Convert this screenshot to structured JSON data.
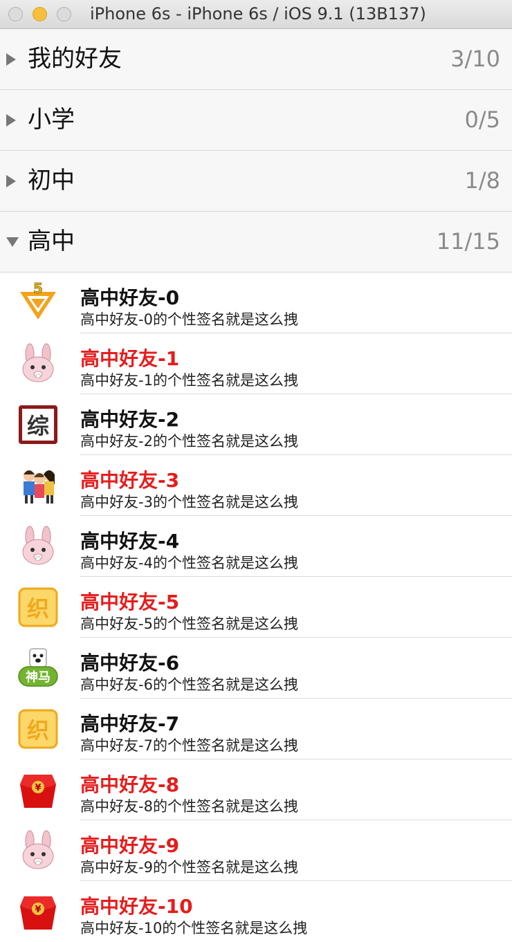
{
  "window": {
    "title": "iPhone 6s - iPhone 6s / iOS 9.1 (13B137)"
  },
  "groups": [
    {
      "name": "我的好友",
      "count": "3/10",
      "expanded": false
    },
    {
      "name": "小学",
      "count": "0/5",
      "expanded": false
    },
    {
      "name": "初中",
      "count": "1/8",
      "expanded": false
    },
    {
      "name": "高中",
      "count": "11/15",
      "expanded": true
    }
  ],
  "friends": [
    {
      "name": "高中好友-0",
      "signature": "高中好友-0的个性签名就是这么拽",
      "vip": false,
      "icon": "v5-badge-icon"
    },
    {
      "name": "高中好友-1",
      "signature": "高中好友-1的个性签名就是这么拽",
      "vip": true,
      "icon": "bunny-icon"
    },
    {
      "name": "高中好友-2",
      "signature": "高中好友-2的个性签名就是这么拽",
      "vip": false,
      "icon": "zong-badge-icon"
    },
    {
      "name": "高中好友-3",
      "signature": "高中好友-3的个性签名就是这么拽",
      "vip": true,
      "icon": "people-group-icon"
    },
    {
      "name": "高中好友-4",
      "signature": "高中好友-4的个性签名就是这么拽",
      "vip": false,
      "icon": "bunny-icon"
    },
    {
      "name": "高中好友-5",
      "signature": "高中好友-5的个性签名就是这么拽",
      "vip": true,
      "icon": "zhi-badge-icon"
    },
    {
      "name": "高中好友-6",
      "signature": "高中好友-6的个性签名就是这么拽",
      "vip": false,
      "icon": "shenma-icon"
    },
    {
      "name": "高中好友-7",
      "signature": "高中好友-7的个性签名就是这么拽",
      "vip": false,
      "icon": "zhi-badge-icon"
    },
    {
      "name": "高中好友-8",
      "signature": "高中好友-8的个性签名就是这么拽",
      "vip": true,
      "icon": "red-envelope-icon"
    },
    {
      "name": "高中好友-9",
      "signature": "高中好友-9的个性签名就是这么拽",
      "vip": true,
      "icon": "bunny-icon"
    },
    {
      "name": "高中好友-10",
      "signature": "高中好友-10的个性签名就是这么拽",
      "vip": true,
      "icon": "red-envelope-icon"
    }
  ],
  "colors": {
    "vip_name": "#e61c1c",
    "normal_name": "#111111",
    "count": "#8a8a8a"
  },
  "icon_glyphs": {
    "zong": "综",
    "zhi": "织",
    "shenma": "神马",
    "yuan": "¥",
    "five": "5"
  }
}
